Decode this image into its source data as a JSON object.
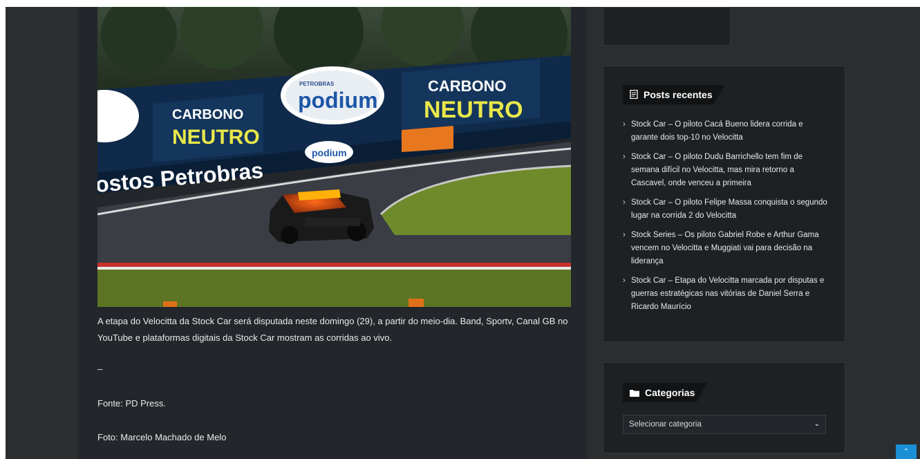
{
  "article": {
    "image_alt": "Stock Car race car on track with Petrobras podium and Carbono Neutro banners",
    "banner_text": {
      "carbono": "CARBONO",
      "neutro": "NEUTRO",
      "podium": "podium",
      "petrobras_small": "PETROBRAS",
      "postos": "ostos Petrobras"
    },
    "paragraph1": "A etapa do Velocitta da Stock Car será disputada neste domingo (29), a partir do meio-dia. Band, Sportv, Canal GB no YouTube e plataformas digitais da Stock Car mostram as corridas ao vivo.",
    "dash": "–",
    "fonte": "Fonte: PD Press.",
    "foto": "Foto: Marcelo Machado de Melo"
  },
  "sidebar": {
    "recent_posts": {
      "title": "Posts recentes",
      "icon": "document-icon",
      "items": [
        {
          "label": "Stock Car – O piloto Cacá Bueno lidera corrida e garante dois top-10 no Velocitta"
        },
        {
          "label": "Stock Car – O piloto Dudu Barrichello tem fim de semana difícil no Velocitta, mas mira retorno a Cascavel, onde venceu a primeira"
        },
        {
          "label": "Stock Car – O piloto Felipe Massa conquista o segundo lugar na corrida 2 do Velocitta"
        },
        {
          "label": "Stock Series – Os piloto Gabriel Robe e Arthur Gama vencem no Velocitta e Muggiati vai para decisão na liderança"
        },
        {
          "label": "Stock Car – Etapa do Velocitta marcada por disputas e guerras estratégicas nas vitórias de Daniel Serra e Ricardo Maurício"
        }
      ]
    },
    "categories": {
      "title": "Categorias",
      "icon": "folder-icon",
      "select_value": "Selecionar categoria"
    }
  },
  "scroll_top": {
    "icon": "chevron-up-icon",
    "glyph": "⌃"
  },
  "colors": {
    "accent": "#1a8fd6",
    "page_bg": "#2b2e31",
    "widget_bg": "#1e2124"
  }
}
